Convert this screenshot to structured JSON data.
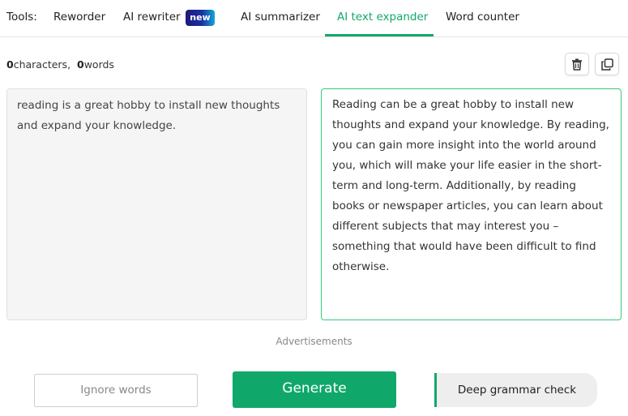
{
  "tools": {
    "label": "Tools:",
    "tabs": [
      {
        "label": "Reworder"
      },
      {
        "label": "AI rewriter",
        "badge": "new"
      },
      {
        "label": "AI summarizer"
      },
      {
        "label": "AI text expander",
        "active": true
      },
      {
        "label": "Word counter"
      }
    ]
  },
  "counts": {
    "characters_value": "0",
    "characters_label": "characters,",
    "words_value": "0",
    "words_label": "words"
  },
  "icons": {
    "clear": "trash-icon",
    "copy": "copy-icon"
  },
  "input": {
    "text": "reading is a great hobby to install new thoughts and expand your knowledge."
  },
  "output": {
    "text": "Reading can be a great hobby to install new thoughts and expand your knowledge. By reading, you can gain more insight into the world around you, which will make your life easier in the short-term and long-term. Additionally, by reading books or newspaper articles, you can learn about different subjects that may interest you – something that would have been difficult to find otherwise."
  },
  "ads": {
    "label": "Advertisements"
  },
  "actions": {
    "ignore_label": "Ignore words",
    "generate_label": "Generate",
    "grammar_label": "Deep grammar check"
  },
  "colors": {
    "accent": "#12a86a",
    "generate_bg": "#0fa86a",
    "output_border": "#37c97a",
    "badge_start": "#1d1a7a",
    "badge_end": "#13a7d8"
  }
}
